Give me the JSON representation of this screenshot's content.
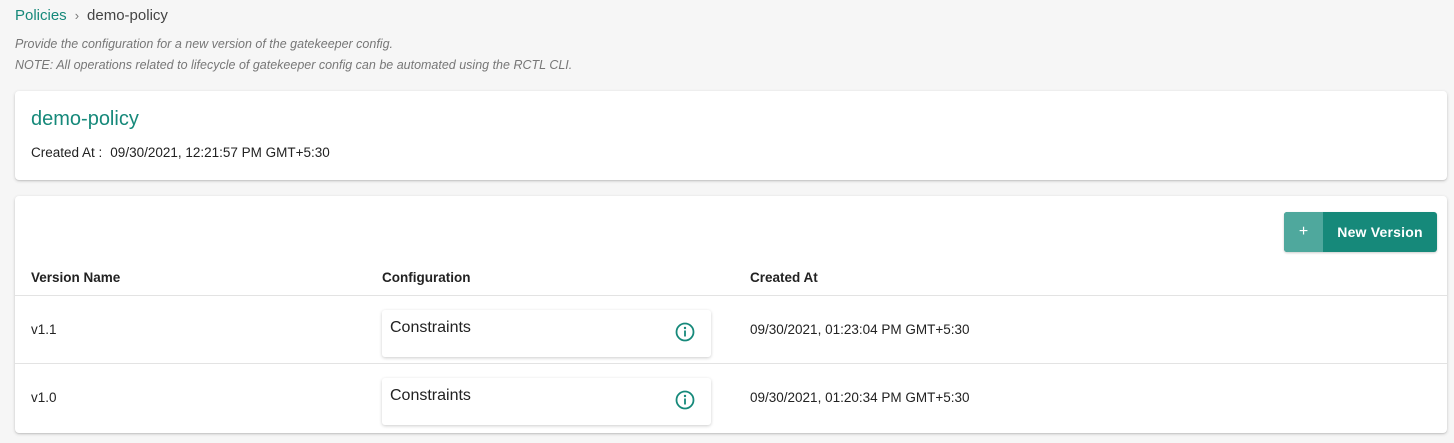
{
  "breadcrumb": {
    "parent": "Policies",
    "separator": "›",
    "current": "demo-policy"
  },
  "description": {
    "line1": "Provide the configuration for a new version of the gatekeeper config.",
    "line2": "NOTE: All operations related to lifecycle of gatekeeper config can be automated using the RCTL CLI."
  },
  "policy": {
    "name": "demo-policy",
    "created_label": "Created At :",
    "created_value": "09/30/2021, 12:21:57 PM GMT+5:30"
  },
  "toolbar": {
    "new_version_icon": "+",
    "new_version_label": "New Version"
  },
  "table": {
    "headers": [
      "Version Name",
      "Configuration",
      "Created At"
    ],
    "rows": [
      {
        "version": "v1.1",
        "configuration": "Constraints",
        "created": "09/30/2021, 01:23:04 PM GMT+5:30"
      },
      {
        "version": "v1.0",
        "configuration": "Constraints",
        "created": "09/30/2021, 01:20:34 PM GMT+5:30"
      }
    ]
  },
  "colors": {
    "accent": "#16897a",
    "background": "#f6f6f6"
  },
  "icons": {
    "info": "info-icon",
    "add": "plus-icon"
  }
}
